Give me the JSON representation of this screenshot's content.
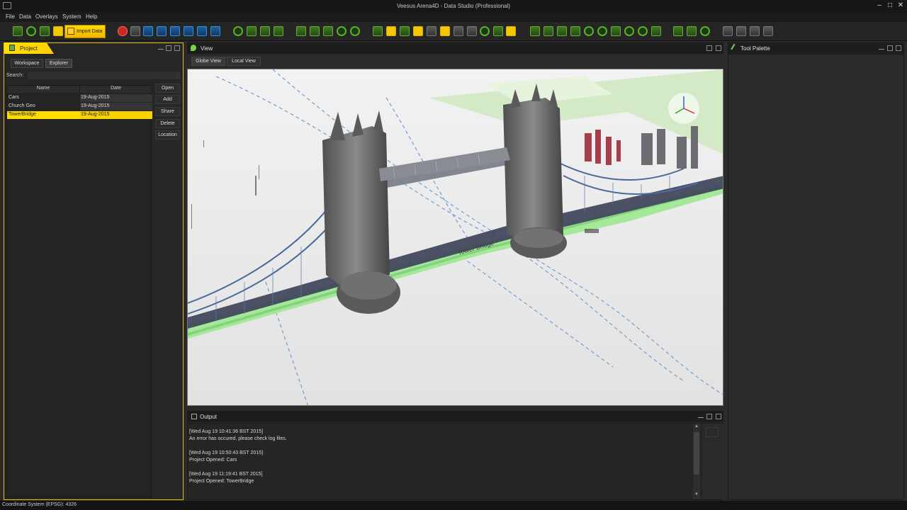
{
  "window": {
    "title": "Veesus Arena4D - Data Studio (Professional)"
  },
  "menu": [
    "File",
    "Data",
    "Overlays",
    "System",
    "Help"
  ],
  "toolbar": {
    "import_label": "Import Data"
  },
  "project_panel": {
    "title": "Project",
    "tabs": [
      "Workspace",
      "Explorer"
    ],
    "search_label": "Search:",
    "search_value": "",
    "columns": [
      "Name",
      "Date"
    ],
    "rows": [
      {
        "name": "Cars",
        "date": "19-Aug-2015",
        "selected": false
      },
      {
        "name": "Church Geo",
        "date": "19-Aug-2015",
        "selected": false
      },
      {
        "name": "TowerBridge",
        "date": "19-Aug-2015",
        "selected": true
      }
    ],
    "buttons": [
      "Open",
      "Add",
      "Share",
      "Delete",
      "Location"
    ]
  },
  "view_panel": {
    "title": "View",
    "tabs": [
      "Globe View",
      "Local View"
    ],
    "road_label": "Tower Bridge"
  },
  "output_panel": {
    "title": "Output",
    "lines": [
      "[Wed Aug 19 10:41:36 BST 2015]",
      "An error has occured, please check log files.",
      "[Wed Aug 19 10:50:43 BST 2015]",
      "Project Opened: Cars",
      "[Wed Aug 19 11:19:41 BST 2015]",
      "Project Opened: TowerBridge"
    ]
  },
  "tool_palette": {
    "title": "Tool Palette"
  },
  "status": {
    "text": "Coordinate System (EPSG): 4326"
  },
  "colors": {
    "accent": "#ffdd00",
    "selection": "#ffdd00",
    "map_road": "#a6e89a",
    "background": "#2a2a2a"
  }
}
